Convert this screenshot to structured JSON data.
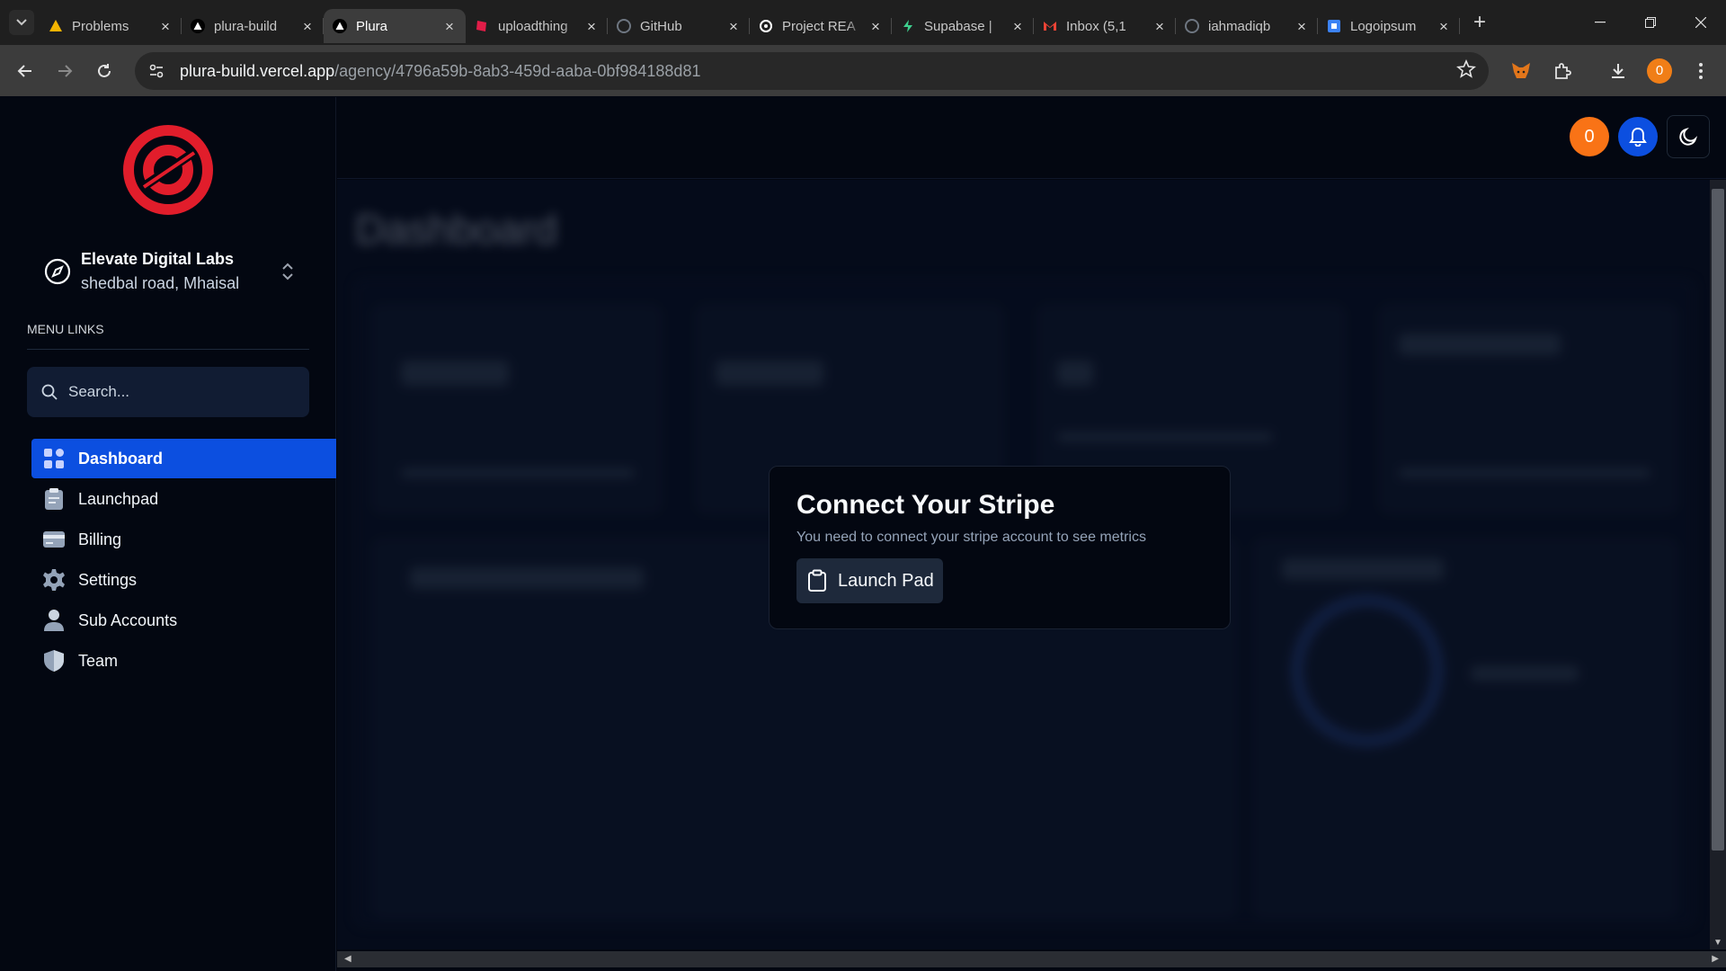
{
  "browser": {
    "tabs": [
      {
        "title": "Problems",
        "icon": "triangle-up-icon",
        "color": "#f4b400"
      },
      {
        "title": "plura-build",
        "icon": "vercel-icon",
        "color": "#ffffff"
      },
      {
        "title": "Plura",
        "icon": "vercel-icon",
        "color": "#ffffff",
        "active": true
      },
      {
        "title": "uploadthing",
        "icon": "uploadthing-icon",
        "color": "#e11d48"
      },
      {
        "title": "GitHub",
        "icon": "github-icon",
        "color": "#6e7681"
      },
      {
        "title": "Project REA",
        "icon": "openai-icon",
        "color": "#ffffff"
      },
      {
        "title": "Supabase |",
        "icon": "supabase-icon",
        "color": "#3ecf8e"
      },
      {
        "title": "Inbox (5,1",
        "icon": "gmail-icon",
        "color": "#ea4335"
      },
      {
        "title": "iahmadiqb",
        "icon": "github-icon",
        "color": "#6e7681"
      },
      {
        "title": "Logoipsum",
        "icon": "logoipsum-icon",
        "color": "#3b82f6"
      }
    ],
    "url_host": "plura-build.vercel.app",
    "url_path": "/agency/4796a59b-8ab3-459d-aaba-0bf984188d81",
    "profile_count": "0"
  },
  "sidebar": {
    "account_name": "Elevate Digital Labs",
    "account_address": "shedbal road, Mhaisal",
    "menu_heading": "MENU LINKS",
    "search_placeholder": "Search...",
    "items": [
      {
        "label": "Dashboard",
        "icon": "dashboard-grid-icon",
        "active": true
      },
      {
        "label": "Launchpad",
        "icon": "clipboard-icon"
      },
      {
        "label": "Billing",
        "icon": "credit-card-icon"
      },
      {
        "label": "Settings",
        "icon": "gear-icon"
      },
      {
        "label": "Sub Accounts",
        "icon": "person-icon"
      },
      {
        "label": "Team",
        "icon": "shield-icon"
      }
    ]
  },
  "topbar": {
    "notification_count": "0"
  },
  "main": {
    "page_title": "Dashboard",
    "stripe_card": {
      "title": "Connect Your Stripe",
      "description": "You need to connect your stripe account to see metrics",
      "button_label": "Launch Pad"
    }
  },
  "colors": {
    "accent": "#0c4fe0",
    "logo": "#e11d2b",
    "badge": "#f97316"
  }
}
